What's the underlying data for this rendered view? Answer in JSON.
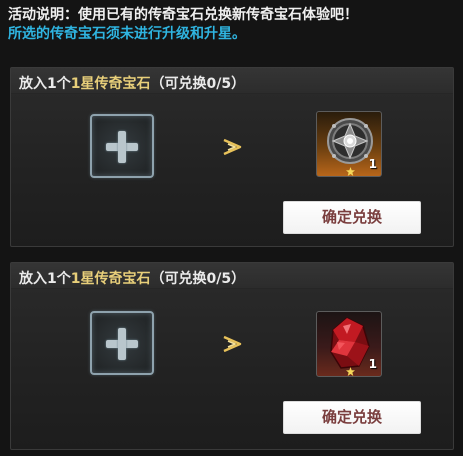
{
  "description": {
    "line1": "活动说明：使用已有的传奇宝石兑换新传奇宝石体验吧！",
    "line2": "所选的传奇宝石须未进行升级和升星。"
  },
  "panels": [
    {
      "title_prefix": "放入1个",
      "title_highlight": "1星传奇宝石",
      "title_suffix": "（可兑换0/5）",
      "add_slot_icon": "plus-icon",
      "arrow_icon": "double-chevron-right-icon",
      "reward_icon": "shield-gem-icon",
      "reward_count": "1",
      "reward_stars": 1,
      "button_label": "确定兑换",
      "colors": {
        "item_bg": "#b8661a"
      }
    },
    {
      "title_prefix": "放入1个",
      "title_highlight": "1星传奇宝石",
      "title_suffix": "（可兑换0/5）",
      "add_slot_icon": "plus-icon",
      "arrow_icon": "double-chevron-right-icon",
      "reward_icon": "red-crystal-gem-icon",
      "reward_count": "1",
      "reward_stars": 1,
      "button_label": "确定兑换",
      "colors": {
        "item_bg": "#6a2a1c"
      }
    }
  ],
  "colors": {
    "description_highlight": "#2fb4e0",
    "title_highlight": "#e8cf7a",
    "button_text": "#7a3e3e",
    "arrow": "#e8c25a"
  }
}
